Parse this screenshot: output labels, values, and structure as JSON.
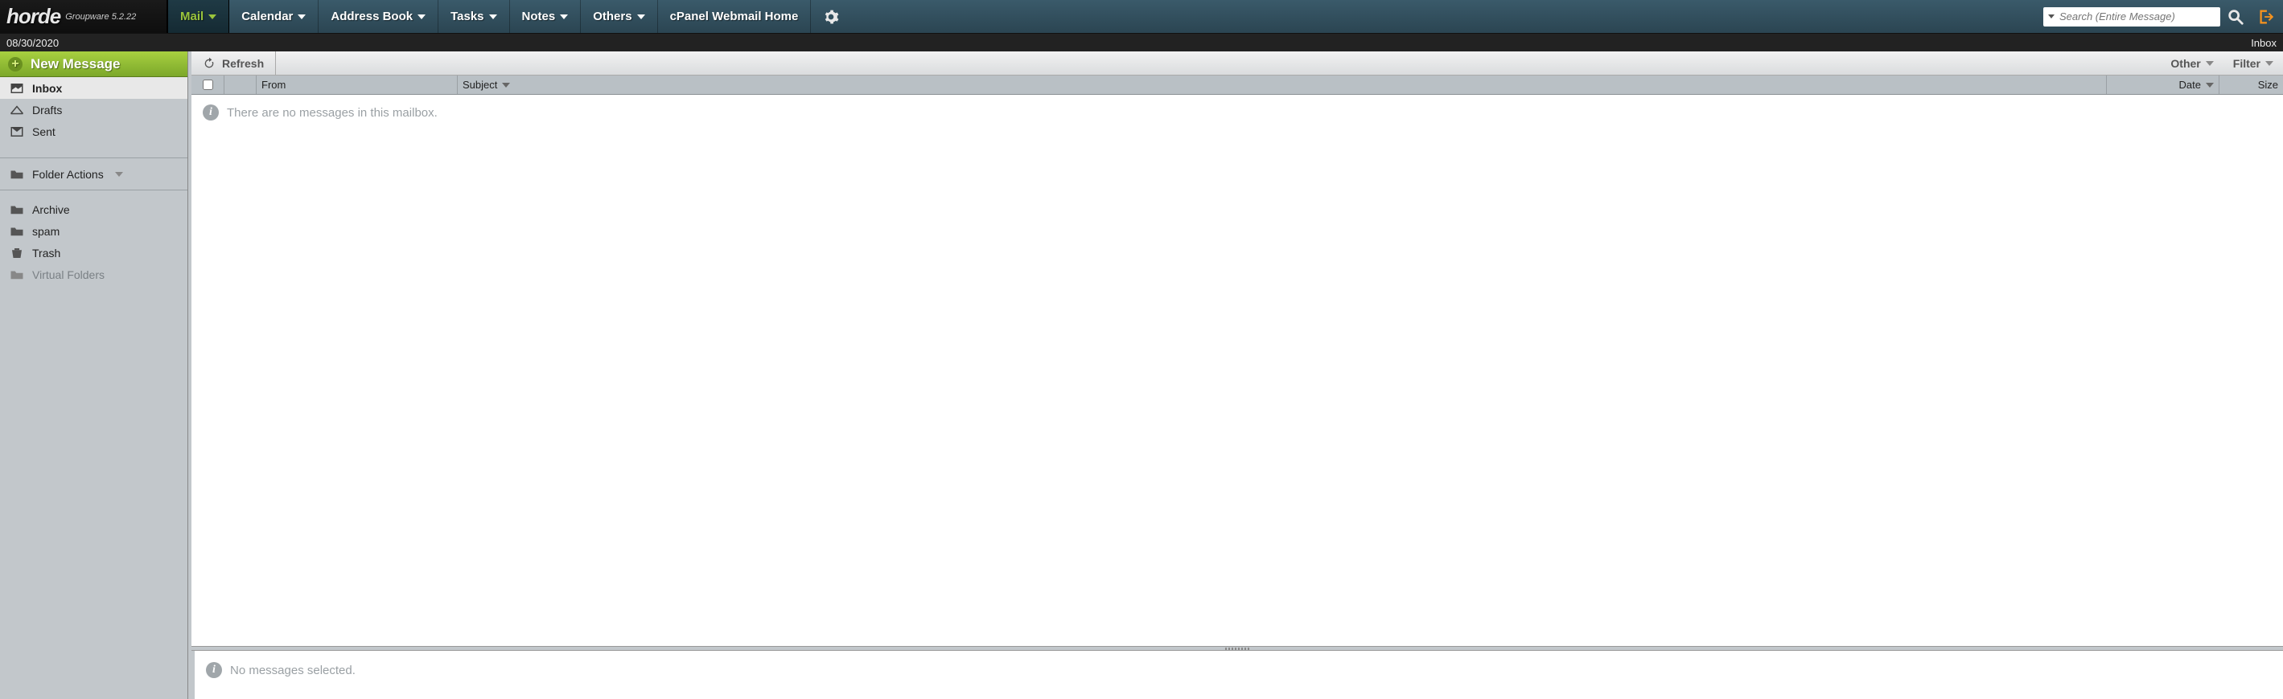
{
  "brand": {
    "name": "horde",
    "tagline": "Groupware 5.2.22"
  },
  "nav": {
    "mail": "Mail",
    "calendar": "Calendar",
    "addressbook": "Address Book",
    "tasks": "Tasks",
    "notes": "Notes",
    "others": "Others",
    "cpanel": "cPanel Webmail Home"
  },
  "search": {
    "placeholder": "Search (Entire Message)"
  },
  "subbar": {
    "date": "08/30/2020",
    "context": "Inbox"
  },
  "sidebar": {
    "new_message": "New Message",
    "inbox": "Inbox",
    "drafts": "Drafts",
    "sent": "Sent",
    "folder_actions": "Folder Actions",
    "archive": "Archive",
    "spam": "spam",
    "trash": "Trash",
    "virtual": "Virtual Folders"
  },
  "toolbar": {
    "refresh": "Refresh",
    "other": "Other",
    "filter": "Filter"
  },
  "columns": {
    "from": "From",
    "subject": "Subject",
    "date": "Date",
    "size": "Size"
  },
  "messages": {
    "empty": "There are no messages in this mailbox."
  },
  "preview": {
    "empty": "No messages selected."
  }
}
